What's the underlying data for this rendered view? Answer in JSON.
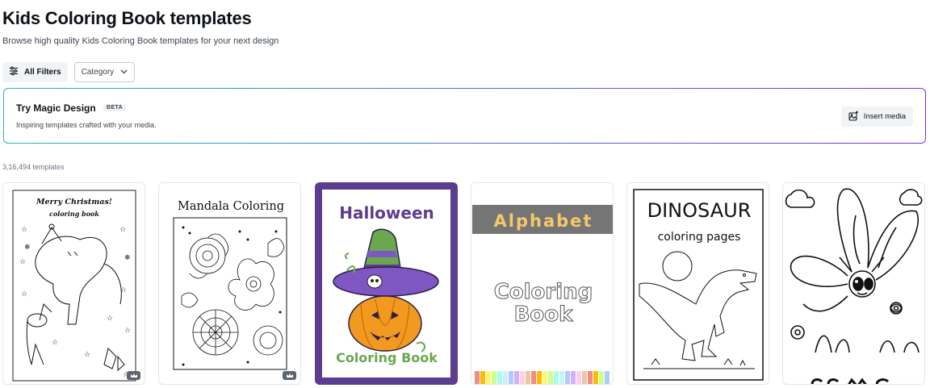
{
  "header": {
    "title": "Kids Coloring Book templates",
    "subtitle": "Browse high quality Kids Coloring Book templates for your next design"
  },
  "filters": {
    "all_filters_label": "All Filters",
    "category_label": "Category"
  },
  "magic_design": {
    "title": "Try Magic Design",
    "badge": "BETA",
    "description": "Inspiring templates crafted with your media.",
    "insert_label": "Insert media"
  },
  "results": {
    "count_label": "3,16,494 templates"
  },
  "templates": [
    {
      "heading": "Merry Christmas!",
      "subheading": "coloring book",
      "premium": true
    },
    {
      "heading": "Mandala Coloring",
      "premium": true
    },
    {
      "heading": "Halloween",
      "subheading": "Coloring Book",
      "accent": "#5b3c8f",
      "premium": false
    },
    {
      "heading": "Alphabet",
      "subheading_line1": "Coloring",
      "subheading_line2": "Book",
      "premium": false
    },
    {
      "heading": "DINOSAUR",
      "subheading": "coloring pages",
      "premium": false
    },
    {
      "heading": "",
      "premium": false
    }
  ],
  "colors": {
    "gradient_start": "#21b9b6",
    "gradient_end": "#7d2ae8",
    "halloween_purple": "#5b3c8f",
    "halloween_green": "#6aa84f",
    "pumpkin_orange": "#f29a1f"
  }
}
